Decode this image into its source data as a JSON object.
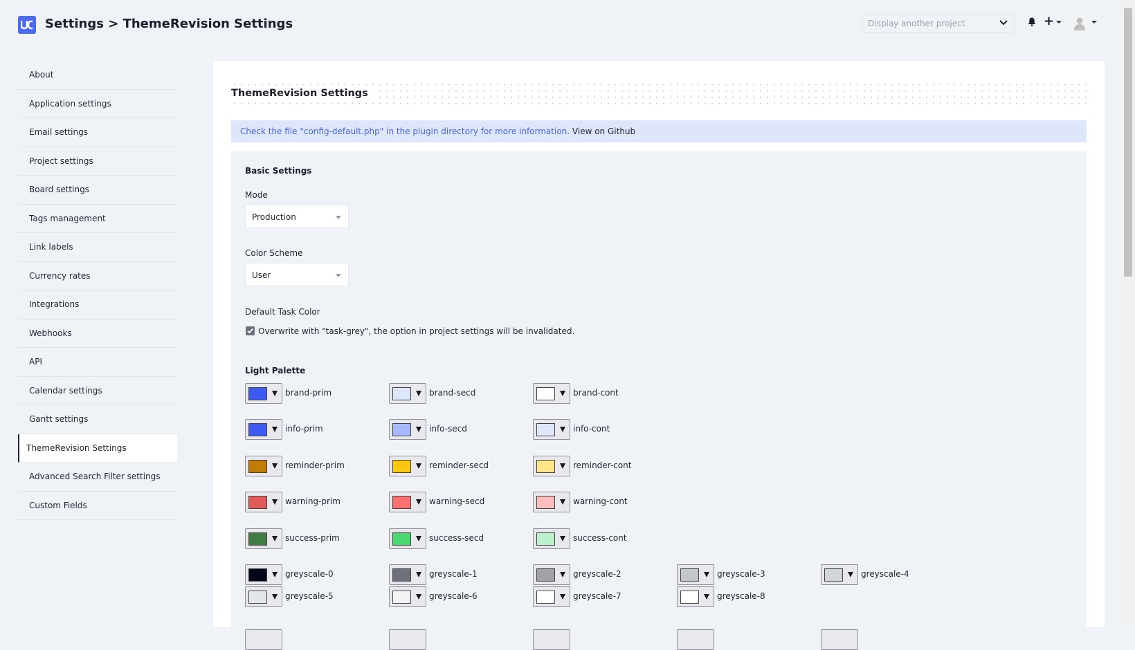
{
  "header": {
    "title": "Settings > ThemeRevision Settings",
    "project_placeholder": "Display another project"
  },
  "sidebar": {
    "items": [
      {
        "label": "About"
      },
      {
        "label": "Application settings"
      },
      {
        "label": "Email settings"
      },
      {
        "label": "Project settings"
      },
      {
        "label": "Board settings"
      },
      {
        "label": "Tags management"
      },
      {
        "label": "Link labels"
      },
      {
        "label": "Currency rates"
      },
      {
        "label": "Integrations"
      },
      {
        "label": "Webhooks"
      },
      {
        "label": "API"
      },
      {
        "label": "Calendar settings"
      },
      {
        "label": "Gantt settings"
      },
      {
        "label": "ThemeRevision Settings",
        "active": true
      },
      {
        "label": "Advanced Search Filter settings"
      },
      {
        "label": "Custom Fields"
      }
    ]
  },
  "main": {
    "section_title": "ThemeRevision Settings",
    "info_text": "Check the file \"config-default.php\" in the plugin directory for more information.",
    "info_link": "View on Github",
    "basic_settings_title": "Basic Settings",
    "mode_label": "Mode",
    "mode_value": "Production",
    "scheme_label": "Color Scheme",
    "scheme_value": "User",
    "default_task_color_label": "Default Task Color",
    "overwrite_checked": true,
    "overwrite_text": "Overwrite with \"task-grey\", the option in project settings will be invalidated.",
    "light_palette_title": "Light Palette",
    "palette": [
      {
        "name": "brand-prim",
        "color": "#3d5af1"
      },
      {
        "name": "brand-secd",
        "color": "#dde6fb"
      },
      {
        "name": "brand-cont",
        "color": "#ffffff"
      },
      {
        "name": "info-prim",
        "color": "#3d5af1"
      },
      {
        "name": "info-secd",
        "color": "#a8b8ff"
      },
      {
        "name": "info-cont",
        "color": "#dde6fb"
      },
      {
        "name": "reminder-prim",
        "color": "#c07c07"
      },
      {
        "name": "reminder-secd",
        "color": "#f9c80e"
      },
      {
        "name": "reminder-cont",
        "color": "#ffe58a"
      },
      {
        "name": "warning-prim",
        "color": "#e05a5a"
      },
      {
        "name": "warning-secd",
        "color": "#ff7070"
      },
      {
        "name": "warning-cont",
        "color": "#ffbdbd"
      },
      {
        "name": "success-prim",
        "color": "#3f7d44"
      },
      {
        "name": "success-secd",
        "color": "#4cd870"
      },
      {
        "name": "success-cont",
        "color": "#bdf0cc"
      },
      {
        "name": "greyscale-0",
        "color": "#05051a"
      },
      {
        "name": "greyscale-1",
        "color": "#6e7179"
      },
      {
        "name": "greyscale-2",
        "color": "#a0a2a8"
      },
      {
        "name": "greyscale-3",
        "color": "#c3c6cc"
      },
      {
        "name": "greyscale-4",
        "color": "#d2d5da"
      },
      {
        "name": "greyscale-5",
        "color": "#e4e7ea"
      },
      {
        "name": "greyscale-6",
        "color": "#f1f3f5"
      },
      {
        "name": "greyscale-7",
        "color": "#ffffff"
      },
      {
        "name": "greyscale-8",
        "color": "#ffffff"
      }
    ]
  }
}
